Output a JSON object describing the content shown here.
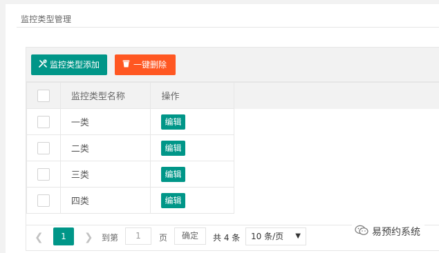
{
  "panel": {
    "title": "监控类型管理"
  },
  "toolbar": {
    "add_label": "监控类型添加",
    "add_icon": "tools-icon",
    "delete_all_label": "一键删除",
    "delete_all_icon": "trash-icon"
  },
  "table": {
    "headers": {
      "name": "监控类型名称",
      "operation": "操作"
    },
    "rows": [
      {
        "name": "一类",
        "action": "编辑"
      },
      {
        "name": "二类",
        "action": "编辑"
      },
      {
        "name": "三类",
        "action": "编辑"
      },
      {
        "name": "四类",
        "action": "编辑"
      }
    ]
  },
  "pagination": {
    "current_page": "1",
    "goto_label": "到第",
    "goto_value": "1",
    "page_label": "页",
    "confirm_label": "确定",
    "total_text": "共 4 条",
    "page_size": "10 条/页"
  },
  "watermark": {
    "text": "易预约系统"
  },
  "colors": {
    "primary": "#009688",
    "danger": "#ff5722",
    "border": "#e6e6e6",
    "header_bg": "#f2f2f2"
  }
}
